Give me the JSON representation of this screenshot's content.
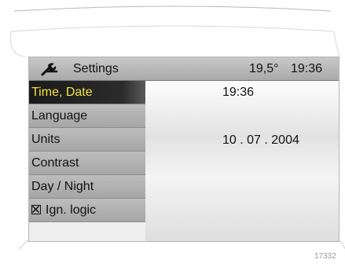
{
  "header": {
    "icon": "wrench-icon",
    "title": "Settings",
    "temperature": "19,5°",
    "clock": "19:36"
  },
  "menu": {
    "items": [
      {
        "label": "Time, Date",
        "selected": true
      },
      {
        "label": "Language"
      },
      {
        "label": "Units"
      },
      {
        "label": "Contrast"
      },
      {
        "label": "Day / Night"
      },
      {
        "label": "Ign. logic",
        "checkbox": "checked"
      }
    ]
  },
  "content": {
    "time_value": "19:36",
    "date_value": "10 . 07 . 2004"
  },
  "figure_ref": "17332",
  "colors": {
    "selected_text": "#f5e33c",
    "selected_bg": "#1a1a1a",
    "header_bg": "#b5b5b5"
  }
}
